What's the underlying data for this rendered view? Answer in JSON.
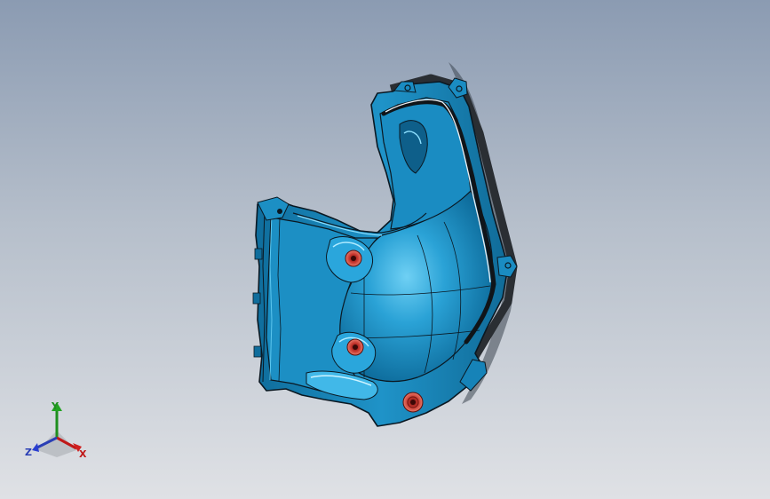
{
  "viewport": {
    "background_top": "#8b9bb2",
    "background_bottom": "#dfe1e5"
  },
  "model": {
    "part_color": "#1683b8",
    "highlight_color": "#5cc6ee",
    "edge_color": "#0a1822",
    "hole_color": "#c4342c"
  },
  "triad": {
    "y_label": "Y",
    "z_label": "Z",
    "x_label": "X",
    "y_color": "#1e8f1e",
    "z_color": "#2a3fb5",
    "x_color": "#c01818"
  }
}
